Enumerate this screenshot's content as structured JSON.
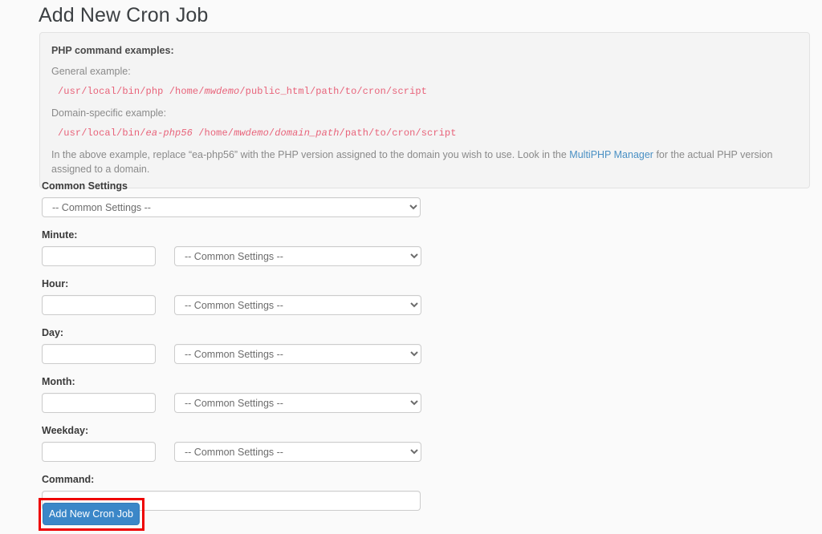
{
  "page": {
    "title": "Add New Cron Job"
  },
  "info_panel": {
    "heading": "PHP command examples:",
    "general_label": "General example:",
    "general_code": {
      "pre": "/usr/local/bin/php /home/",
      "em1": "mwdemo",
      "post": "/public_html/path/to/cron/script"
    },
    "domain_label": "Domain-specific example:",
    "domain_code": {
      "pre": "/usr/local/bin/",
      "em1": "ea-php56",
      "mid": " /home/",
      "em2": "mwdemo",
      "mid2": "/",
      "em3": "domain_path",
      "post": "/path/to/cron/script"
    },
    "note_before_link": "In the above example, replace “ea-php56” with the PHP version assigned to the domain you wish to use. Look in the ",
    "note_link": "MultiPHP Manager",
    "note_after_link": " for the actual PHP version assigned to a domain."
  },
  "form": {
    "common_settings_label": "Common Settings",
    "common_settings_value": "-- Common Settings --",
    "fields": [
      {
        "label": "Minute:",
        "input_value": "",
        "select_value": "-- Common Settings --"
      },
      {
        "label": "Hour:",
        "input_value": "",
        "select_value": "-- Common Settings --"
      },
      {
        "label": "Day:",
        "input_value": "",
        "select_value": "-- Common Settings --"
      },
      {
        "label": "Month:",
        "input_value": "",
        "select_value": "-- Common Settings --"
      },
      {
        "label": "Weekday:",
        "input_value": "",
        "select_value": "-- Common Settings --"
      }
    ],
    "command_label": "Command:",
    "command_value": "",
    "submit_label": "Add New Cron Job"
  },
  "colors": {
    "page_background": "#fafafa",
    "panel_background": "#f4f4f4",
    "code_text": "#e8637a",
    "link": "#4a90c4",
    "button": "#3b87c8",
    "annotation_box": "#ee0000"
  }
}
